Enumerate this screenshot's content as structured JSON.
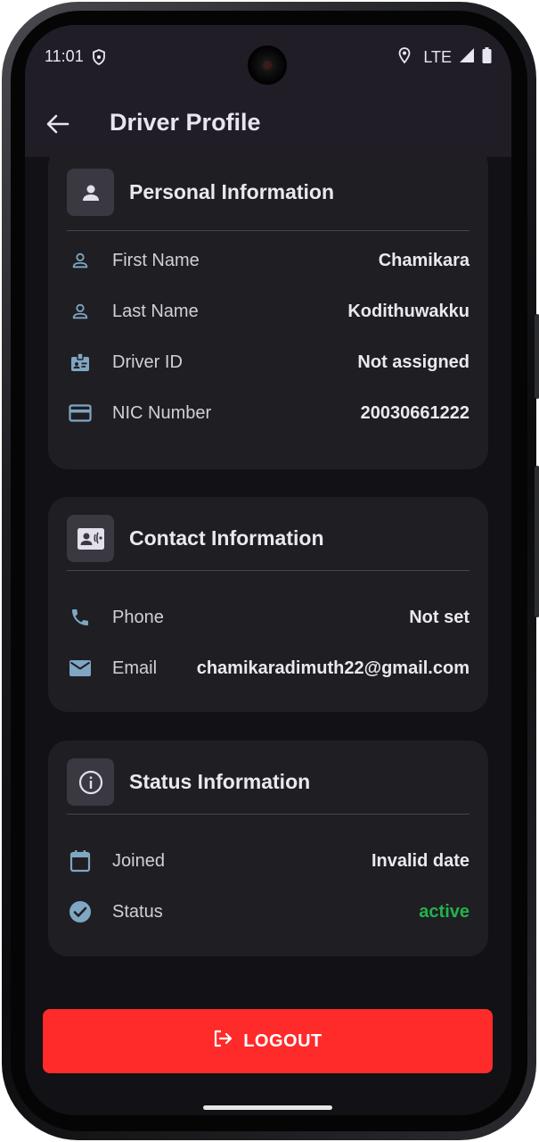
{
  "status_bar": {
    "time": "11:01",
    "network": "LTE"
  },
  "app_bar": {
    "title": "Driver Profile"
  },
  "personal": {
    "title": "Personal Information",
    "rows": [
      {
        "icon": "person-icon",
        "label": "First Name",
        "value": "Chamikara"
      },
      {
        "icon": "person-icon",
        "label": "Last Name",
        "value": "Kodithuwakku"
      },
      {
        "icon": "badge-icon",
        "label": "Driver ID",
        "value": "Not assigned"
      },
      {
        "icon": "credit-card-icon",
        "label": "NIC Number",
        "value": "20030661222"
      }
    ]
  },
  "contact": {
    "title": "Contact Information",
    "rows": [
      {
        "icon": "phone-icon",
        "label": "Phone",
        "value": "Not set"
      },
      {
        "icon": "mail-icon",
        "label": "Email",
        "value": "chamikaradimuth22@gmail.com"
      }
    ]
  },
  "status": {
    "title": "Status Information",
    "rows": [
      {
        "icon": "calendar-icon",
        "label": "Joined",
        "value": "Invalid date"
      },
      {
        "icon": "check-circle-icon",
        "label": "Status",
        "value": "active"
      }
    ]
  },
  "logout": {
    "label": "LOGOUT"
  },
  "colors": {
    "app_bar": "#201d27",
    "background": "#121115",
    "card": "#1f1e23",
    "icon_accent": "#7fa6c2",
    "logout": "#ff2a2a",
    "status_active": "#22b24c"
  }
}
